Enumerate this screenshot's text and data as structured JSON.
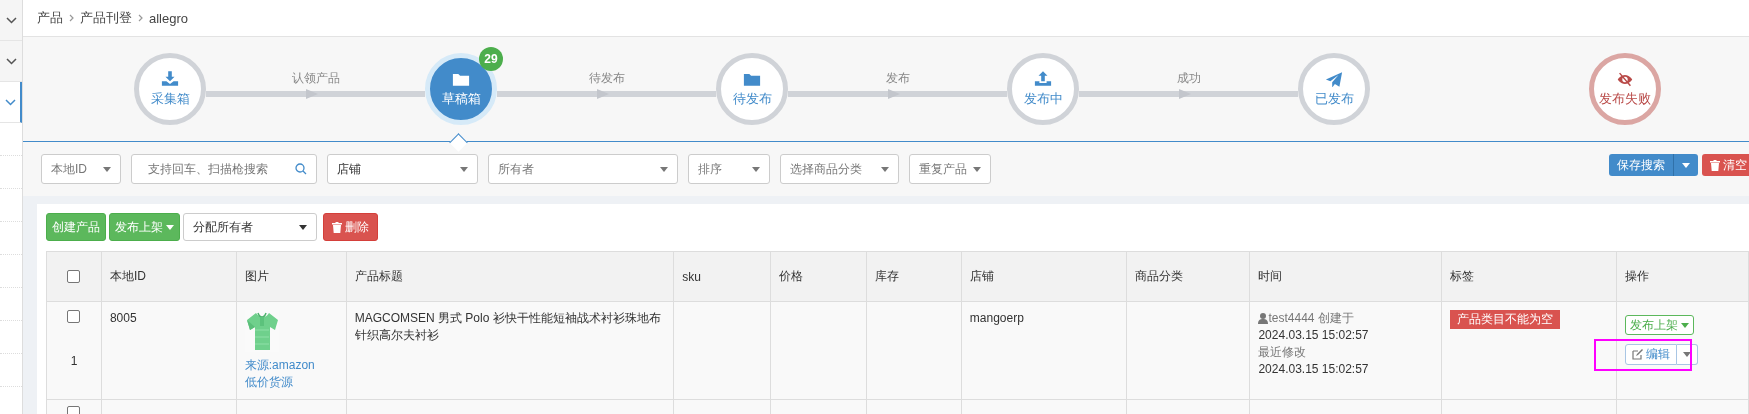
{
  "sidebar": {
    "items": [
      {
        "selected": false
      },
      {
        "selected": false
      },
      {
        "selected": true
      }
    ]
  },
  "breadcrumb": [
    "产品",
    "产品刊登",
    "allegro"
  ],
  "steps": [
    {
      "label": "采集箱",
      "kind": "normal",
      "selected": false
    },
    {
      "label": "草稿箱",
      "kind": "normal",
      "selected": true,
      "badge": "29"
    },
    {
      "label": "待发布",
      "kind": "normal",
      "selected": false
    },
    {
      "label": "发布中",
      "kind": "normal",
      "selected": false
    },
    {
      "label": "已发布",
      "kind": "normal",
      "selected": false
    },
    {
      "label": "发布失败",
      "kind": "failed",
      "selected": false
    }
  ],
  "connectors": [
    "认领产品",
    "待发布",
    "发布",
    "成功"
  ],
  "filters": [
    {
      "kind": "select",
      "text": "本地ID"
    },
    {
      "kind": "search",
      "placeholder": "支持回车、扫描枪搜索"
    },
    {
      "kind": "select",
      "value": "店铺"
    },
    {
      "kind": "select",
      "text": "所有者"
    },
    {
      "kind": "select",
      "text": "排序"
    },
    {
      "kind": "select",
      "text": "选择商品分类"
    },
    {
      "kind": "select",
      "text": "重复产品"
    }
  ],
  "save_search": "保存搜索",
  "clear": "清空",
  "actions": {
    "create": "创建产品",
    "publish": "发布上架",
    "assign": "分配所有者",
    "delete": "删除"
  },
  "table": {
    "header_checked": false,
    "next_row": {
      "checked": false
    },
    "columns": [
      "本地ID",
      "图片",
      "产品标题",
      "sku",
      "价格",
      "库存",
      "店铺",
      "商品分类",
      "时间",
      "标签",
      "操作"
    ],
    "rows": [
      {
        "checked": false,
        "id": "8005",
        "index": "1",
        "source": "来源:amazon",
        "source_note": "低价货源",
        "title": "MAGCOMSEN 男式 Polo 衫快干性能短袖战术衬衫珠地布针织高尔夫衬衫",
        "shop": "mangoerp",
        "user": "test4444",
        "created_label": "创建于",
        "created": "2024.03.15 15:02:57",
        "modified_label": "最近修改",
        "modified": "2024.03.15 15:02:57",
        "tag": "产品类目不能为空",
        "publish": "发布上架",
        "edit": "编辑",
        "highlighted": true
      }
    ]
  }
}
